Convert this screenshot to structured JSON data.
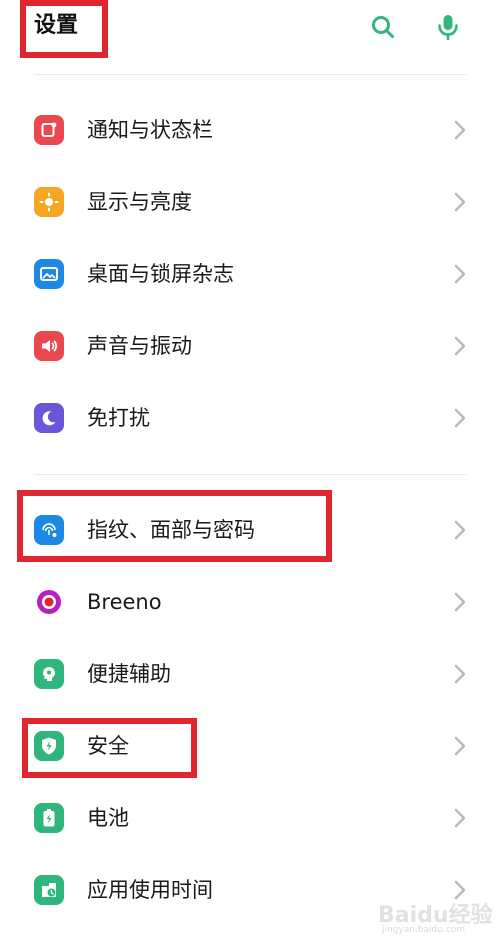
{
  "header": {
    "title": "设置",
    "search_icon": "search-icon",
    "mic_icon": "mic-icon"
  },
  "colors": {
    "accent": "#2fb67c",
    "highlight_box": "#e0262e",
    "chevron": "#b9b9b9"
  },
  "settings": {
    "group1": [
      {
        "label": "通知与状态栏",
        "icon": "notification-icon",
        "color": "#e8484e"
      },
      {
        "label": "显示与亮度",
        "icon": "brightness-icon",
        "color": "#f5a623"
      },
      {
        "label": "桌面与锁屏杂志",
        "icon": "wallpaper-icon",
        "color": "#1e88e5"
      },
      {
        "label": "声音与振动",
        "icon": "sound-icon",
        "color": "#e8484e"
      },
      {
        "label": "免打扰",
        "icon": "moon-icon",
        "color": "#6c55d6"
      }
    ],
    "group2": [
      {
        "label": "指纹、面部与密码",
        "icon": "fingerprint-icon",
        "color": "#1e88e5"
      },
      {
        "label": "Breeno",
        "icon": "breeno-icon",
        "color": "#b81fc2"
      },
      {
        "label": "便捷辅助",
        "icon": "assist-icon",
        "color": "#2fb67c"
      },
      {
        "label": "安全",
        "icon": "shield-icon",
        "color": "#2fb67c"
      },
      {
        "label": "电池",
        "icon": "battery-icon",
        "color": "#2fb67c"
      },
      {
        "label": "应用使用时间",
        "icon": "usage-time-icon",
        "color": "#2fb67c"
      }
    ]
  },
  "watermark": {
    "text": "Baidu经验",
    "sub": "jingyan.baidu.com"
  }
}
